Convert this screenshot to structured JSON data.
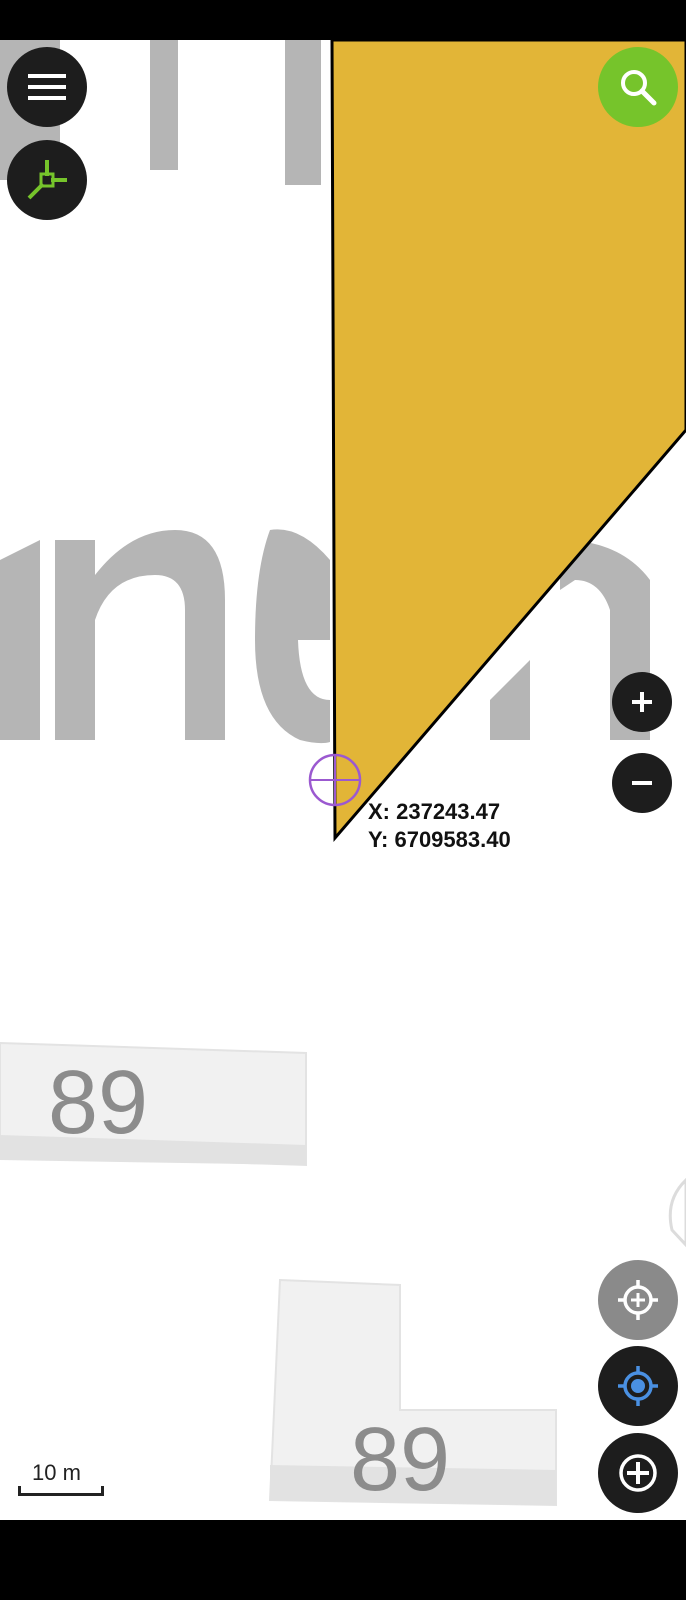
{
  "map": {
    "background_labels": {
      "street_fragment_top": "rn",
      "street_fragment_middle": "nen",
      "house_number_1": "89",
      "house_number_2": "89"
    },
    "polygon_fill_color": "#E2B537",
    "polygon_stroke_color": "#000000",
    "crosshair_color": "#9B59D0"
  },
  "coordinates": {
    "x_label": "X: 237243.47",
    "y_label": "Y: 6709583.40"
  },
  "scale": {
    "label": "10 m"
  },
  "buttons": {
    "menu": {
      "icon": "menu-icon"
    },
    "digitize": {
      "icon": "vertex-tool-icon",
      "color": "#76C42B"
    },
    "search": {
      "icon": "search-icon",
      "color": "#76C42B"
    },
    "zoom_in": {
      "icon": "plus-icon"
    },
    "zoom_out": {
      "icon": "minus-icon"
    },
    "center_crosshair": {
      "icon": "crosshair-icon"
    },
    "gps_locate": {
      "icon": "gps-location-icon",
      "color": "#4A90E2"
    },
    "add_vertex": {
      "icon": "add-circle-icon"
    }
  }
}
